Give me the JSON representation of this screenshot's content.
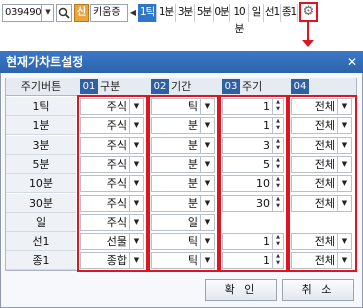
{
  "toolbar": {
    "code": "039490",
    "sin_label": "신",
    "stock_name": "키움증",
    "periods": [
      "1틱",
      "1분",
      "3분",
      "5분",
      "0분",
      "10분",
      "일",
      "선1",
      "종1"
    ],
    "selected_period": "1틱"
  },
  "dialog": {
    "title": "현재가차트설정",
    "columns": {
      "row_header": "주기버튼",
      "type": "구분",
      "period": "기간",
      "cycle": "주기"
    },
    "badges": [
      "01",
      "02",
      "03",
      "04"
    ],
    "rows": [
      {
        "label": "1틱",
        "type": "주식",
        "period": "틱",
        "cycle": "1",
        "range": "전체"
      },
      {
        "label": "1분",
        "type": "주식",
        "period": "분",
        "cycle": "1",
        "range": "전체"
      },
      {
        "label": "3분",
        "type": "주식",
        "period": "분",
        "cycle": "3",
        "range": "전체"
      },
      {
        "label": "5분",
        "type": "주식",
        "period": "분",
        "cycle": "5",
        "range": "전체"
      },
      {
        "label": "10분",
        "type": "주식",
        "period": "분",
        "cycle": "10",
        "range": "전체"
      },
      {
        "label": "30분",
        "type": "주식",
        "period": "분",
        "cycle": "30",
        "range": "전체"
      },
      {
        "label": "일",
        "type": "주식",
        "period": "일",
        "cycle": "",
        "range": ""
      },
      {
        "label": "선1",
        "type": "선물",
        "period": "틱",
        "cycle": "1",
        "range": "전체"
      },
      {
        "label": "종1",
        "type": "종합",
        "period": "틱",
        "cycle": "1",
        "range": "전체"
      }
    ],
    "ok_label": "확 인",
    "cancel_label": "취 소"
  },
  "colors": {
    "title_bar": "#2f6bb8",
    "selected_period": "#2f75c8",
    "highlight": "#e0141e",
    "badge": "#2f5fa5"
  }
}
